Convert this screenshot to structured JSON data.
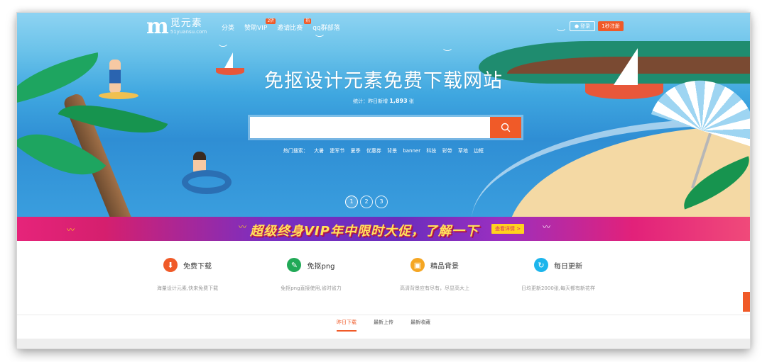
{
  "nav": {
    "logo_mark": "m",
    "logo_name": "觅元素",
    "logo_sub": "51yuansu.com",
    "links": [
      {
        "label": "分类",
        "badge": ""
      },
      {
        "label": "赞助VIP",
        "badge": "2折"
      },
      {
        "label": "邀请比赛",
        "badge": "热"
      },
      {
        "label": "qq群部落",
        "badge": ""
      }
    ],
    "login_label": "登录",
    "register_label": "1秒注册"
  },
  "hero": {
    "title": "免抠设计元素免费下载网站",
    "stats_prefix": "统计：昨日新增",
    "stats_count": "1,893",
    "stats_suffix": "张",
    "search_placeholder": "",
    "hot_label": "热门搜索：",
    "hot_tags": [
      "大暑",
      "建军节",
      "夏季",
      "优惠券",
      "背景",
      "banner",
      "科技",
      "彩带",
      "草地",
      "边框"
    ],
    "slides": [
      "1",
      "2",
      "3"
    ],
    "active_slide": 1
  },
  "promo": {
    "text": "超级终身VIP年中限时大促，了解一下",
    "button_label": "查看详情 >"
  },
  "features": [
    {
      "title": "免费下载",
      "desc": "海量设计元素,快来免费下载",
      "icon": "download-icon",
      "color": "#f05a28"
    },
    {
      "title": "免抠png",
      "desc": "免抠png直接使用,省时省力",
      "icon": "leaf-icon",
      "color": "#21a957"
    },
    {
      "title": "精品背景",
      "desc": "高清背景应有尽有，尽显高大上",
      "icon": "image-icon",
      "color": "#f5a623"
    },
    {
      "title": "每日更新",
      "desc": "日均更新2000张,每天都有新花样",
      "icon": "refresh-icon",
      "color": "#1cb5ec"
    }
  ],
  "tabs": [
    {
      "label": "昨日下载",
      "active": true
    },
    {
      "label": "最新上传",
      "active": false
    },
    {
      "label": "最新收藏",
      "active": false
    }
  ],
  "colors": {
    "accent": "#f05a28",
    "banner_text": "#ffe35a"
  }
}
